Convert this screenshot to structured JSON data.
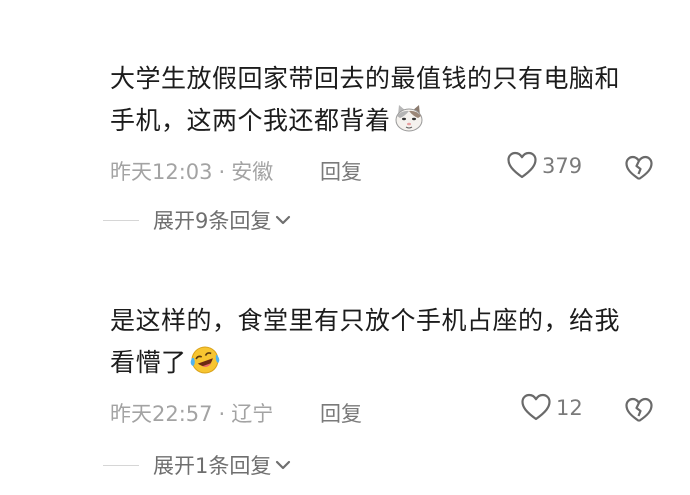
{
  "comments": [
    {
      "text_line1": "大学生放假回家带回去的最值钱的只有电脑和",
      "text_line2": "手机，这两个我还都背着",
      "emoji": "cat-face-emoji",
      "time": "昨天12:03",
      "separator": "·",
      "location": "安徽",
      "reply_label": "回复",
      "likes": "379",
      "expand_label": "展开9条回复"
    },
    {
      "text_line1": "是这样的，食堂里有只放个手机占座的，给我",
      "text_line2": "看懵了",
      "emoji": "laughing-crying-emoji",
      "time": "昨天22:57",
      "separator": "·",
      "location": "辽宁",
      "reply_label": "回复",
      "likes": "12",
      "expand_label": "展开1条回复"
    }
  ],
  "icons": {
    "like": "heart-outline-icon",
    "dislike": "broken-heart-icon",
    "expand": "chevron-down-icon"
  },
  "colors": {
    "text": "#1c1c1c",
    "meta": "#a3a3a3",
    "action": "#7a7a7a",
    "divider": "#d6d6d6"
  }
}
